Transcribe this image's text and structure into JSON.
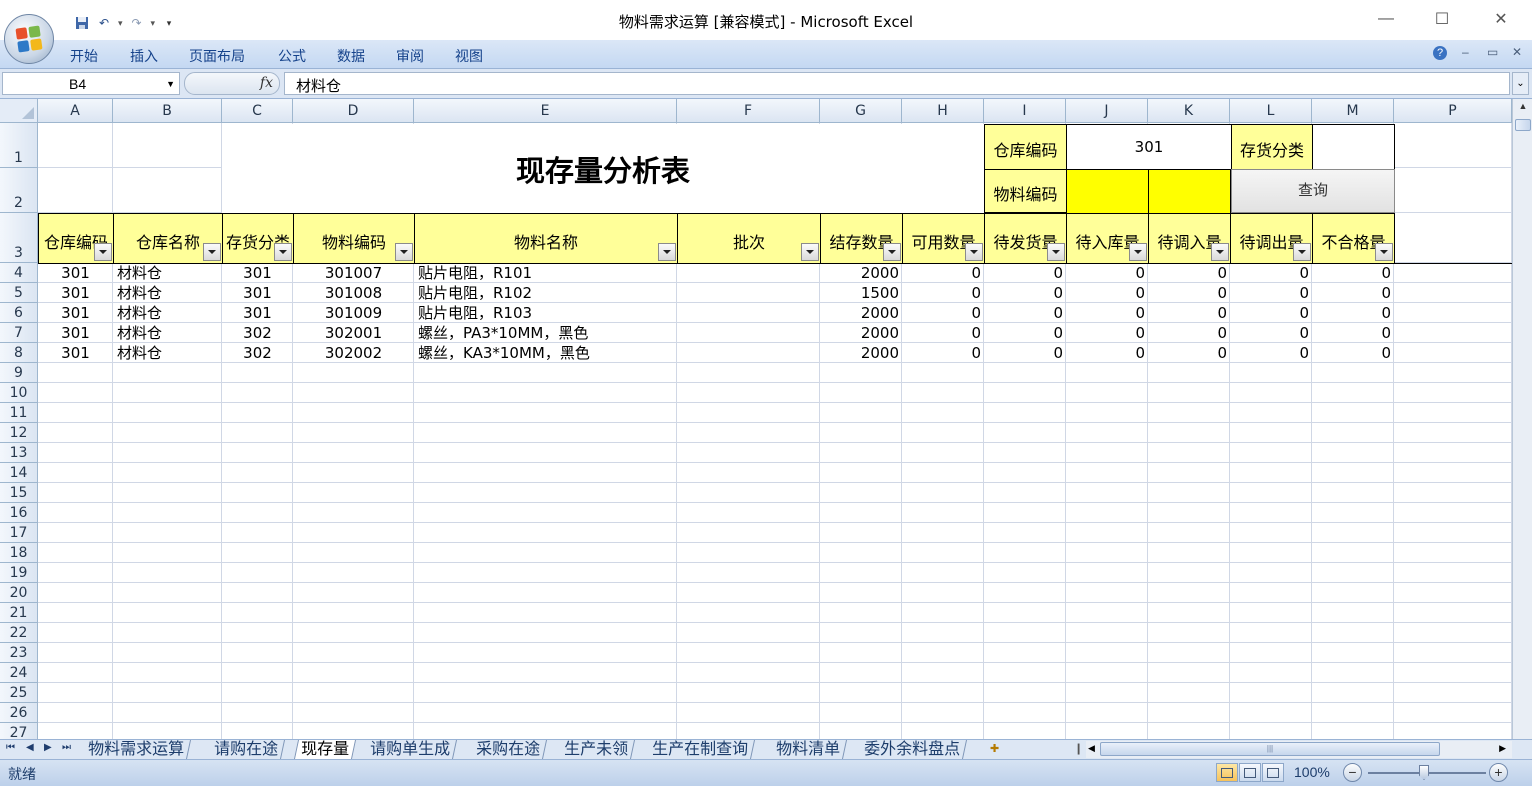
{
  "window": {
    "title": "物料需求运算  [兼容模式] - Microsoft Excel"
  },
  "ribbon": {
    "tabs": [
      "开始",
      "插入",
      "页面布局",
      "公式",
      "数据",
      "审阅",
      "视图"
    ]
  },
  "formula_bar": {
    "name_box": "B4",
    "fx_label": "fx",
    "content": "材料仓"
  },
  "columns": [
    "A",
    "B",
    "C",
    "D",
    "E",
    "F",
    "G",
    "H",
    "I",
    "J",
    "K",
    "L",
    "M",
    "P"
  ],
  "rows": [
    "1",
    "2",
    "3",
    "4",
    "5",
    "6",
    "7",
    "8",
    "9",
    "10",
    "11",
    "12",
    "13",
    "14",
    "15",
    "16",
    "17",
    "18",
    "19",
    "20",
    "21",
    "22",
    "23",
    "24",
    "25",
    "26",
    "27"
  ],
  "sheet": {
    "title": "现存量分析表",
    "warehouse_code_label": "仓库编码",
    "warehouse_code_value": "301",
    "inventory_class_label": "存货分类",
    "inventory_class_value": "",
    "material_code_label": "物料编码",
    "material_code_from": "",
    "material_code_to": "",
    "query_button": "查询",
    "headers": [
      "仓库编码",
      "仓库名称",
      "存货分类",
      "物料编码",
      "物料名称",
      "批次",
      "结存数量",
      "可用数量",
      "待发货量",
      "待入库量",
      "待调入量",
      "待调出量",
      "不合格量"
    ],
    "data_rows": [
      [
        "301",
        "材料仓",
        "301",
        "301007",
        "贴片电阻，R101",
        "",
        "2000",
        "0",
        "0",
        "0",
        "0",
        "0",
        "0"
      ],
      [
        "301",
        "材料仓",
        "301",
        "301008",
        "贴片电阻，R102",
        "",
        "1500",
        "0",
        "0",
        "0",
        "0",
        "0",
        "0"
      ],
      [
        "301",
        "材料仓",
        "301",
        "301009",
        "贴片电阻，R103",
        "",
        "2000",
        "0",
        "0",
        "0",
        "0",
        "0",
        "0"
      ],
      [
        "301",
        "材料仓",
        "302",
        "302001",
        "螺丝，PA3*10MM，黑色",
        "",
        "2000",
        "0",
        "0",
        "0",
        "0",
        "0",
        "0"
      ],
      [
        "301",
        "材料仓",
        "302",
        "302002",
        "螺丝，KA3*10MM，黑色",
        "",
        "2000",
        "0",
        "0",
        "0",
        "0",
        "0",
        "0"
      ]
    ]
  },
  "sheet_tabs": [
    "物料需求运算",
    "请购在途",
    "现存量",
    "请购单生成",
    "采购在途",
    "生产未领",
    "生产在制查询",
    "物料清单",
    "委外余料盘点"
  ],
  "active_sheet": "现存量",
  "status": {
    "text": "就绪",
    "zoom": "100%"
  },
  "colors": {
    "header_fill": "#ffff99",
    "input_fill": "#ffff00",
    "grid_line": "#d0d7e5",
    "ribbon": "#c4d8f2"
  }
}
